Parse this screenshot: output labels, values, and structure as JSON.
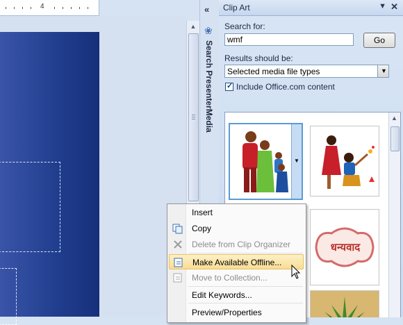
{
  "ruler": {
    "number": "4"
  },
  "presenter_pane": {
    "label": "Search PresenterMedia",
    "collapse_glyph": "«"
  },
  "clipart_pane": {
    "title": "Clip Art",
    "search_label": "Search for:",
    "search_value": "wmf",
    "go_label": "Go",
    "results_label": "Results should be:",
    "results_selected": "Selected media file types",
    "include_label": "Include Office.com content",
    "include_checked": true
  },
  "clips": {
    "hindi_text": "धन्यवाद"
  },
  "context_menu": {
    "items": [
      {
        "label": "Insert",
        "enabled": true
      },
      {
        "label": "Copy",
        "enabled": true
      },
      {
        "label": "Delete from Clip Organizer",
        "enabled": false
      },
      {
        "label": "Make Available Offline...",
        "enabled": true,
        "highlighted": true
      },
      {
        "label": "Move to Collection...",
        "enabled": false
      },
      {
        "label": "Edit Keywords...",
        "enabled": true
      },
      {
        "label": "Preview/Properties",
        "enabled": true
      }
    ]
  },
  "colors": {
    "slide": "#213e8f",
    "highlight": "#f8dc94",
    "pane_bg": "#d8e5f5"
  }
}
